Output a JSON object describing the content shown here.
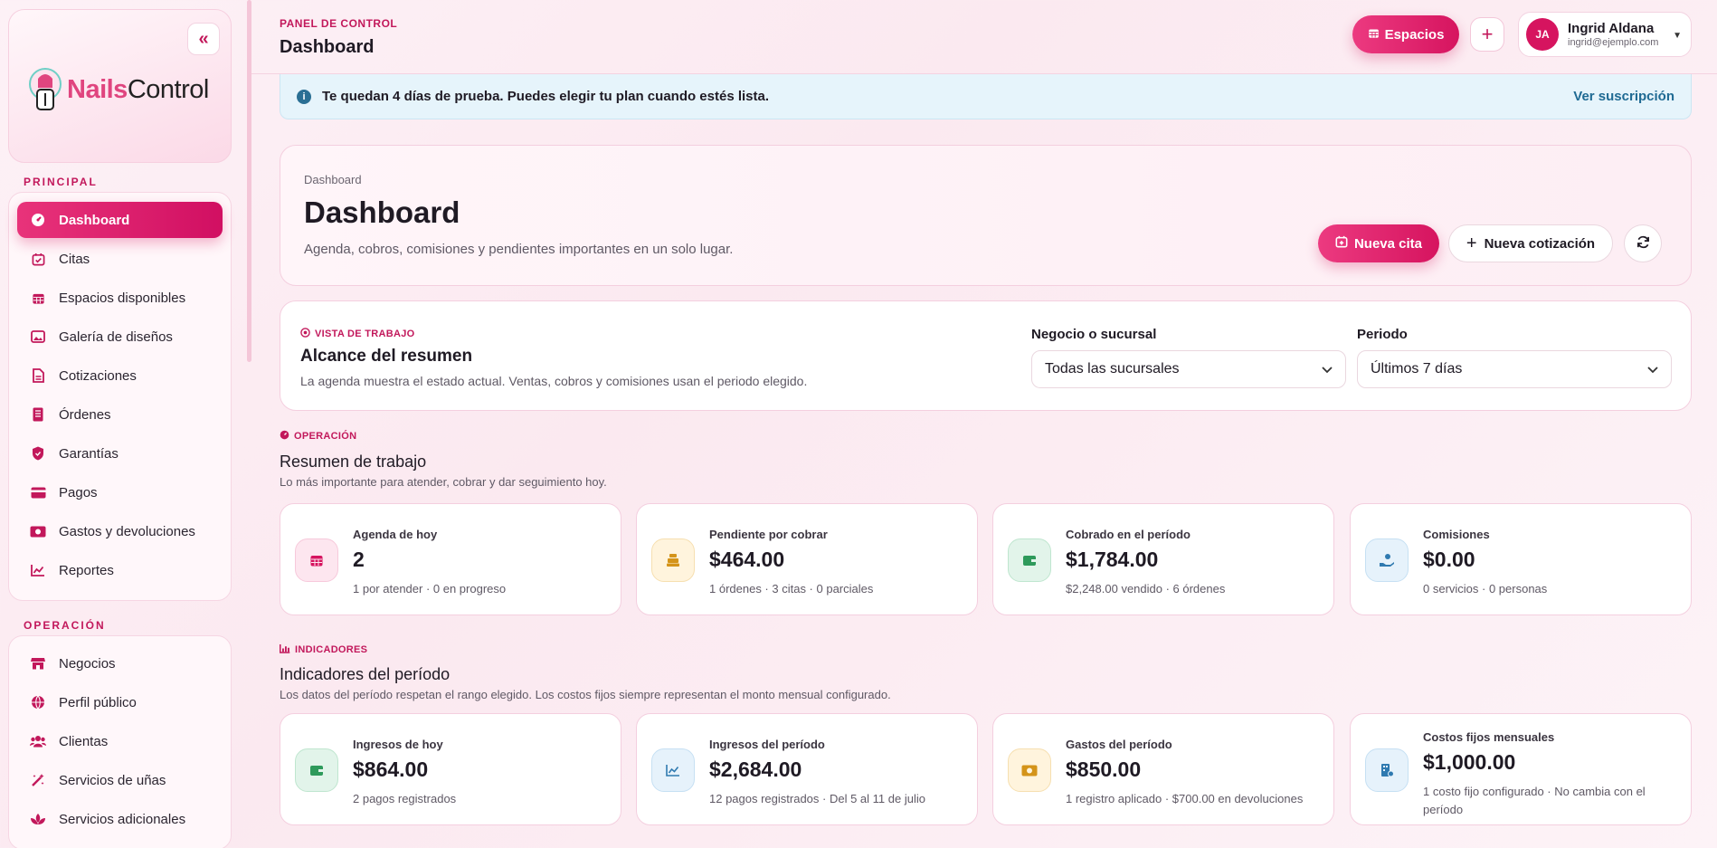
{
  "sidebar": {
    "brand_a": "Nails",
    "brand_b": "Control",
    "principal_title": "PRINCIPAL",
    "principal": [
      {
        "label": "Dashboard",
        "icon": "gauge-icon",
        "active": true
      },
      {
        "label": "Citas",
        "icon": "calendar-check-icon"
      },
      {
        "label": "Espacios disponibles",
        "icon": "calendar-grid-icon"
      },
      {
        "label": "Galería de diseños",
        "icon": "image-icon"
      },
      {
        "label": "Cotizaciones",
        "icon": "document-icon"
      },
      {
        "label": "Órdenes",
        "icon": "receipt-icon"
      },
      {
        "label": "Garantías",
        "icon": "shield-icon"
      },
      {
        "label": "Pagos",
        "icon": "credit-card-icon"
      },
      {
        "label": "Gastos y devoluciones",
        "icon": "money-icon"
      },
      {
        "label": "Reportes",
        "icon": "line-chart-icon"
      }
    ],
    "operacion_title": "OPERACIÓN",
    "operacion": [
      {
        "label": "Negocios",
        "icon": "store-icon"
      },
      {
        "label": "Perfil público",
        "icon": "globe-icon"
      },
      {
        "label": "Clientas",
        "icon": "users-icon"
      },
      {
        "label": "Servicios de uñas",
        "icon": "magic-wand-icon"
      },
      {
        "label": "Servicios adicionales",
        "icon": "lotus-icon"
      }
    ]
  },
  "topbar": {
    "subtitle": "PANEL DE CONTROL",
    "title": "Dashboard",
    "espacios_label": "Espacios",
    "user_initials": "JA",
    "user_name": "Ingrid Aldana",
    "user_email": "ingrid@ejemplo.com"
  },
  "trial": {
    "text": "Te quedan 4 días de prueba. Puedes elegir tu plan cuando estés lista.",
    "link": "Ver suscripción"
  },
  "hero": {
    "breadcrumb": "Dashboard",
    "title": "Dashboard",
    "subtitle": "Agenda, cobros, comisiones y pendientes importantes en un solo lugar.",
    "btn_cita": "Nueva cita",
    "btn_cotizacion": "Nueva cotización"
  },
  "scope": {
    "eyebrow": "VISTA DE TRABAJO",
    "title": "Alcance del resumen",
    "subtitle": "La agenda muestra el estado actual. Ventas, cobros y comisiones usan el periodo elegido.",
    "negocio_label": "Negocio o sucursal",
    "negocio_value": "Todas las sucursales",
    "periodo_label": "Periodo",
    "periodo_value": "Últimos 7 días"
  },
  "operacion": {
    "eyebrow": "OPERACIÓN",
    "title": "Resumen de trabajo",
    "subtitle": "Lo más importante para atender, cobrar y dar seguimiento hoy.",
    "stats": [
      {
        "label": "Agenda de hoy",
        "value": "2",
        "note": "1 por atender · 0 en progreso",
        "icon": "calendar-icon",
        "color": "pink"
      },
      {
        "label": "Pendiente por cobrar",
        "value": "$464.00",
        "note": "1 órdenes · 3 citas · 0 parciales",
        "icon": "cash-register-icon",
        "color": "yellow"
      },
      {
        "label": "Cobrado en el período",
        "value": "$1,784.00",
        "note": "$2,248.00 vendido · 6 órdenes",
        "icon": "wallet-icon",
        "color": "green"
      },
      {
        "label": "Comisiones",
        "value": "$0.00",
        "note": "0 servicios · 0 personas",
        "icon": "hand-coin-icon",
        "color": "blue"
      }
    ]
  },
  "indicadores": {
    "eyebrow": "INDICADORES",
    "title": "Indicadores del período",
    "subtitle": "Los datos del período respetan el rango elegido. Los costos fijos siempre representan el monto mensual configurado.",
    "stats": [
      {
        "label": "Ingresos de hoy",
        "value": "$864.00",
        "note": "2 pagos registrados",
        "icon": "wallet-icon",
        "color": "green"
      },
      {
        "label": "Ingresos del período",
        "value": "$2,684.00",
        "note": "12 pagos registrados · Del 5 al 11 de julio",
        "icon": "line-chart-icon",
        "color": "blue"
      },
      {
        "label": "Gastos del período",
        "value": "$850.00",
        "note": "1 registro aplicado · $700.00 en devoluciones",
        "icon": "money-bill-icon",
        "color": "yellow"
      },
      {
        "label": "Costos fijos mensuales",
        "value": "$1,000.00",
        "note": "1 costo fijo configurado · No cambia con el período",
        "icon": "building-icon",
        "color": "blue"
      }
    ]
  }
}
